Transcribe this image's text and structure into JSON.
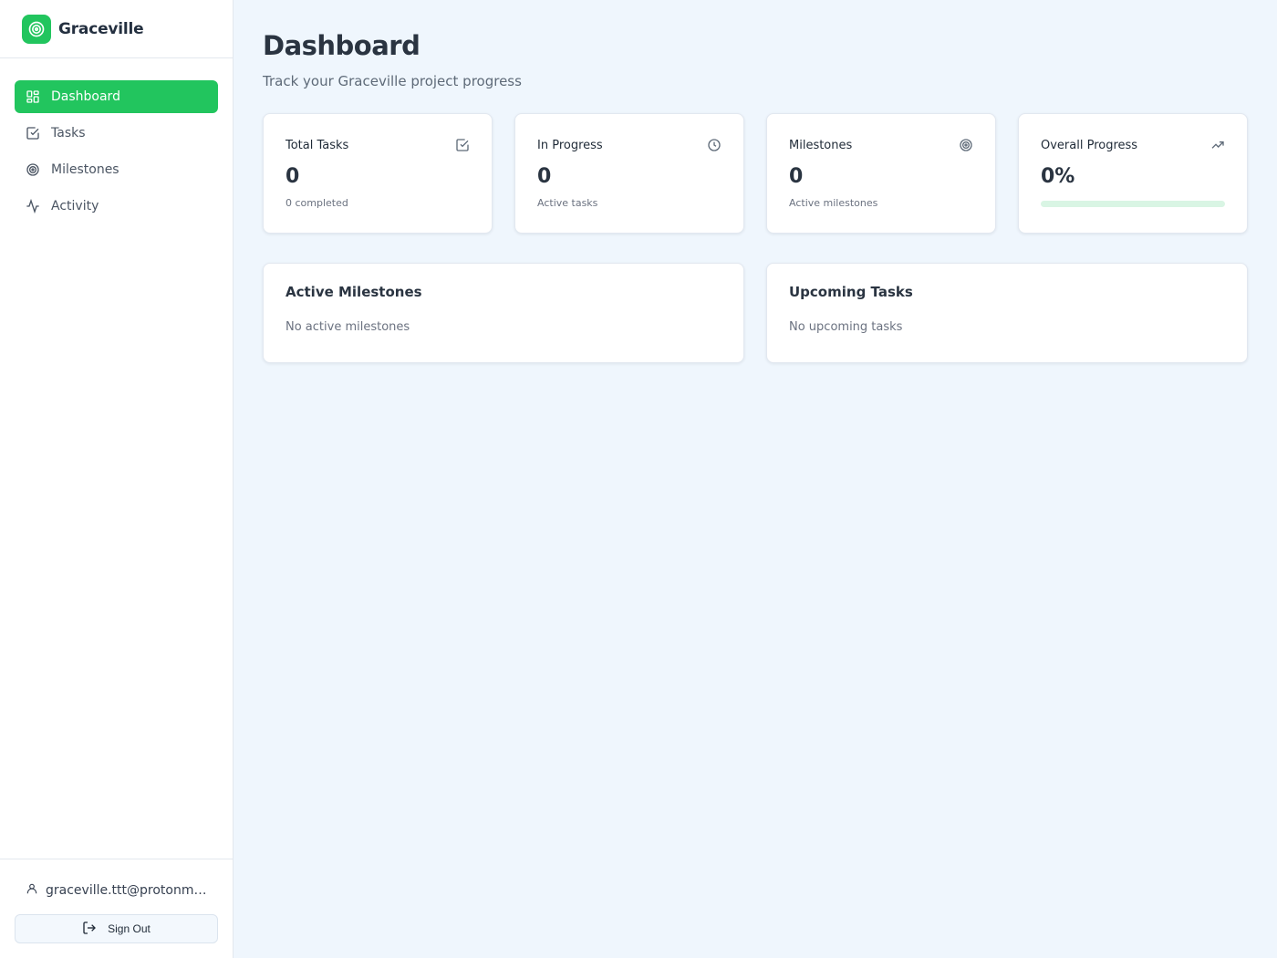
{
  "brand": {
    "name": "Graceville",
    "icon": "target-icon",
    "accent": "#22c55e"
  },
  "nav": [
    {
      "label": "Dashboard",
      "icon": "dashboard-grid-icon",
      "active": true
    },
    {
      "label": "Tasks",
      "icon": "checkbox-icon",
      "active": false
    },
    {
      "label": "Milestones",
      "icon": "target-icon",
      "active": false
    },
    {
      "label": "Activity",
      "icon": "activity-icon",
      "active": false
    }
  ],
  "user": {
    "email": "graceville.ttt@protonmail...",
    "icon": "user-icon"
  },
  "signout": {
    "label": "Sign Out",
    "icon": "logout-icon"
  },
  "page": {
    "title": "Dashboard",
    "subtitle": "Track your Graceville project progress"
  },
  "stats": [
    {
      "label": "Total Tasks",
      "value": "0",
      "sub": "0 completed",
      "icon": "checkbox-icon"
    },
    {
      "label": "In Progress",
      "value": "0",
      "sub": "Active tasks",
      "icon": "clock-icon"
    },
    {
      "label": "Milestones",
      "value": "0",
      "sub": "Active milestones",
      "icon": "target-icon"
    },
    {
      "label": "Overall Progress",
      "value": "0%",
      "progress": 0,
      "icon": "trending-up-icon"
    }
  ],
  "panels": [
    {
      "title": "Active Milestones",
      "empty": "No active milestones"
    },
    {
      "title": "Upcoming Tasks",
      "empty": "No upcoming tasks"
    }
  ]
}
